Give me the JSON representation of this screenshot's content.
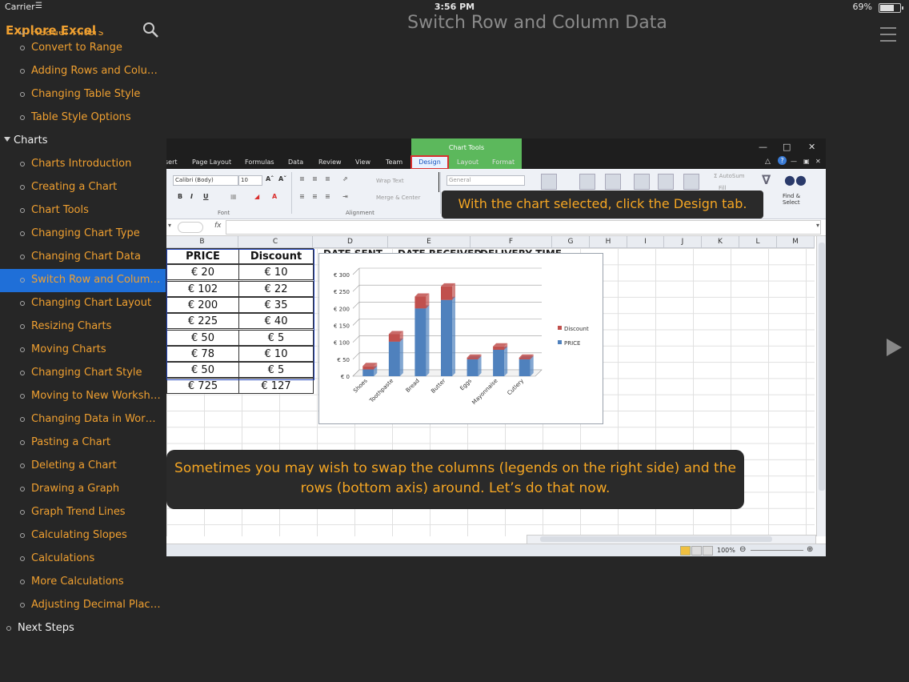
{
  "status_bar": {
    "carrier": "Carrier",
    "time": "3:56 PM",
    "battery": "69%",
    "battery_level": 0.69
  },
  "sidebar": {
    "title": "Explore Excel",
    "partial_item": "Header Filters",
    "items": [
      {
        "label": "Convert to Range",
        "type": "item"
      },
      {
        "label": "Adding Rows and Columns",
        "type": "item"
      },
      {
        "label": "Changing Table Style",
        "type": "item"
      },
      {
        "label": "Table Style Options",
        "type": "item"
      },
      {
        "label": "Charts",
        "type": "section"
      },
      {
        "label": "Charts Introduction",
        "type": "item"
      },
      {
        "label": "Creating a Chart",
        "type": "item"
      },
      {
        "label": "Chart Tools",
        "type": "item"
      },
      {
        "label": "Changing Chart Type",
        "type": "item"
      },
      {
        "label": "Changing Chart Data",
        "type": "item"
      },
      {
        "label": "Switch Row and Column ...",
        "type": "selected"
      },
      {
        "label": "Changing Chart Layout",
        "type": "item"
      },
      {
        "label": "Resizing Charts",
        "type": "item"
      },
      {
        "label": "Moving Charts",
        "type": "item"
      },
      {
        "label": "Changing Chart Style",
        "type": "item"
      },
      {
        "label": "Moving to New Worksheet",
        "type": "item"
      },
      {
        "label": "Changing Data in Works...",
        "type": "item"
      },
      {
        "label": "Pasting a Chart",
        "type": "item"
      },
      {
        "label": "Deleting a Chart",
        "type": "item"
      },
      {
        "label": "Drawing a Graph",
        "type": "item"
      },
      {
        "label": "Graph Trend Lines",
        "type": "item"
      },
      {
        "label": "Calculating Slopes",
        "type": "item"
      },
      {
        "label": "Calculations",
        "type": "item"
      },
      {
        "label": "More Calculations",
        "type": "item"
      },
      {
        "label": "Adjusting Decimal Places",
        "type": "item"
      },
      {
        "label": "Next Steps",
        "type": "white"
      }
    ]
  },
  "page_title": "Switch Row and Column Data",
  "excel": {
    "tabs": [
      "sert",
      "Page Layout",
      "Formulas",
      "Data",
      "Review",
      "View",
      "Team",
      "Design",
      "Layout",
      "Format"
    ],
    "chart_tools_label": "Chart Tools",
    "font_name": "Calibri (Body)",
    "font_size": "10",
    "group_font": "Font",
    "group_alignment": "Alignment",
    "wrap_text": "Wrap Text",
    "merge_center": "Merge & Center",
    "number_format": "General",
    "autosum": "AutoSum",
    "fill": "Fill",
    "find_select": "Find & Select",
    "fx": "fx",
    "columns": [
      "B",
      "C",
      "D",
      "E",
      "F",
      "G",
      "H",
      "I",
      "J",
      "K",
      "L",
      "M"
    ],
    "table_headers": [
      "PRICE",
      "Discount"
    ],
    "hidden_headers": [
      "DATE SENT",
      "DATE RECEIVED",
      "DELIVERY TIME"
    ],
    "table_rows": [
      [
        "€ 20",
        "€ 10"
      ],
      [
        "€ 102",
        "€ 22"
      ],
      [
        "€ 200",
        "€ 35"
      ],
      [
        "€ 225",
        "€ 40"
      ],
      [
        "€ 50",
        "€ 5"
      ],
      [
        "€ 78",
        "€ 10"
      ],
      [
        "€ 50",
        "€ 5"
      ],
      [
        "€ 725",
        "€ 127"
      ]
    ],
    "zoom": "100%"
  },
  "chart_data": {
    "type": "bar",
    "stacked": true,
    "categories": [
      "Shoes",
      "Toothpaste",
      "Bread",
      "Butter",
      "Eggs",
      "Mayonnaise",
      "Cutlery"
    ],
    "series": [
      {
        "name": "PRICE",
        "values": [
          20,
          102,
          200,
          225,
          50,
          78,
          50
        ],
        "color": "#4f81bd"
      },
      {
        "name": "Discount",
        "values": [
          10,
          22,
          35,
          40,
          5,
          10,
          5
        ],
        "color": "#c0504d"
      }
    ],
    "ytick_labels": [
      "€ 0",
      "€ 50",
      "€ 100",
      "€ 150",
      "€ 200",
      "€ 250",
      "€ 300"
    ],
    "ylim": [
      0,
      300
    ],
    "legend": "right"
  },
  "callouts": {
    "design_tip": "With the chart selected, click the Design tab.",
    "swap_tip": "Sometimes you may wish to swap the columns (legends on the right side) and the rows (bottom axis) around. Let’s do that now."
  }
}
